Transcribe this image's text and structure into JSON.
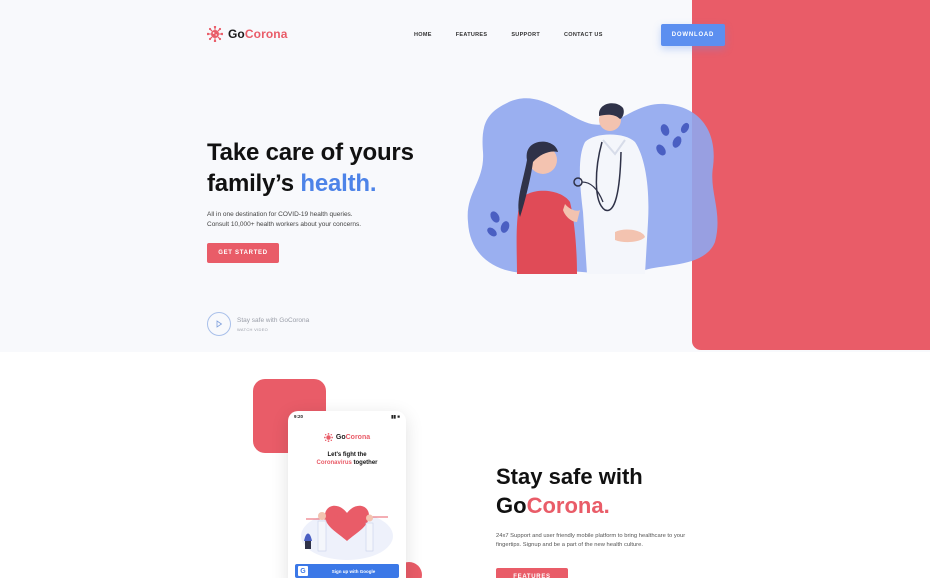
{
  "brand": {
    "go": "Go",
    "corona": "Corona"
  },
  "nav": {
    "items": [
      "HOME",
      "FEATURES",
      "SUPPORT",
      "CONTACT US"
    ]
  },
  "header": {
    "download_label": "DOWNLOAD"
  },
  "hero": {
    "title_line1": "Take care of yours",
    "title_line2_prefix": "family’s ",
    "title_line2_accent": "health.",
    "description_line1": "All in one destination for COVID-19 health queries.",
    "description_line2": "Consult 10,000+ health workers about your concerns.",
    "cta_label": "GET STARTED",
    "video_title": "Stay safe with GoCorona",
    "video_sub": "WATCH VIDEO"
  },
  "phone": {
    "time": "9:20",
    "brand_go": "Go",
    "brand_corona": "Corona",
    "heading_line1": "Let's fight the",
    "heading_accent": "Coronavirus",
    "heading_suffix": " together",
    "google_label": "Sign up with Google"
  },
  "section2": {
    "title_line1": "Stay safe with",
    "title_go": "Go",
    "title_corona": "Corona.",
    "description": "24x7 Support and user friendly mobile platform to bring healthcare to your fingertips. Signup and be a part of the new health culture.",
    "cta_label": "FEATURES"
  },
  "colors": {
    "accent_red": "#e95c68",
    "accent_blue": "#5c8ff0",
    "blob_blue": "#8fa6ee"
  },
  "icons": [
    "virus-logo-icon",
    "play-icon",
    "google-icon"
  ]
}
